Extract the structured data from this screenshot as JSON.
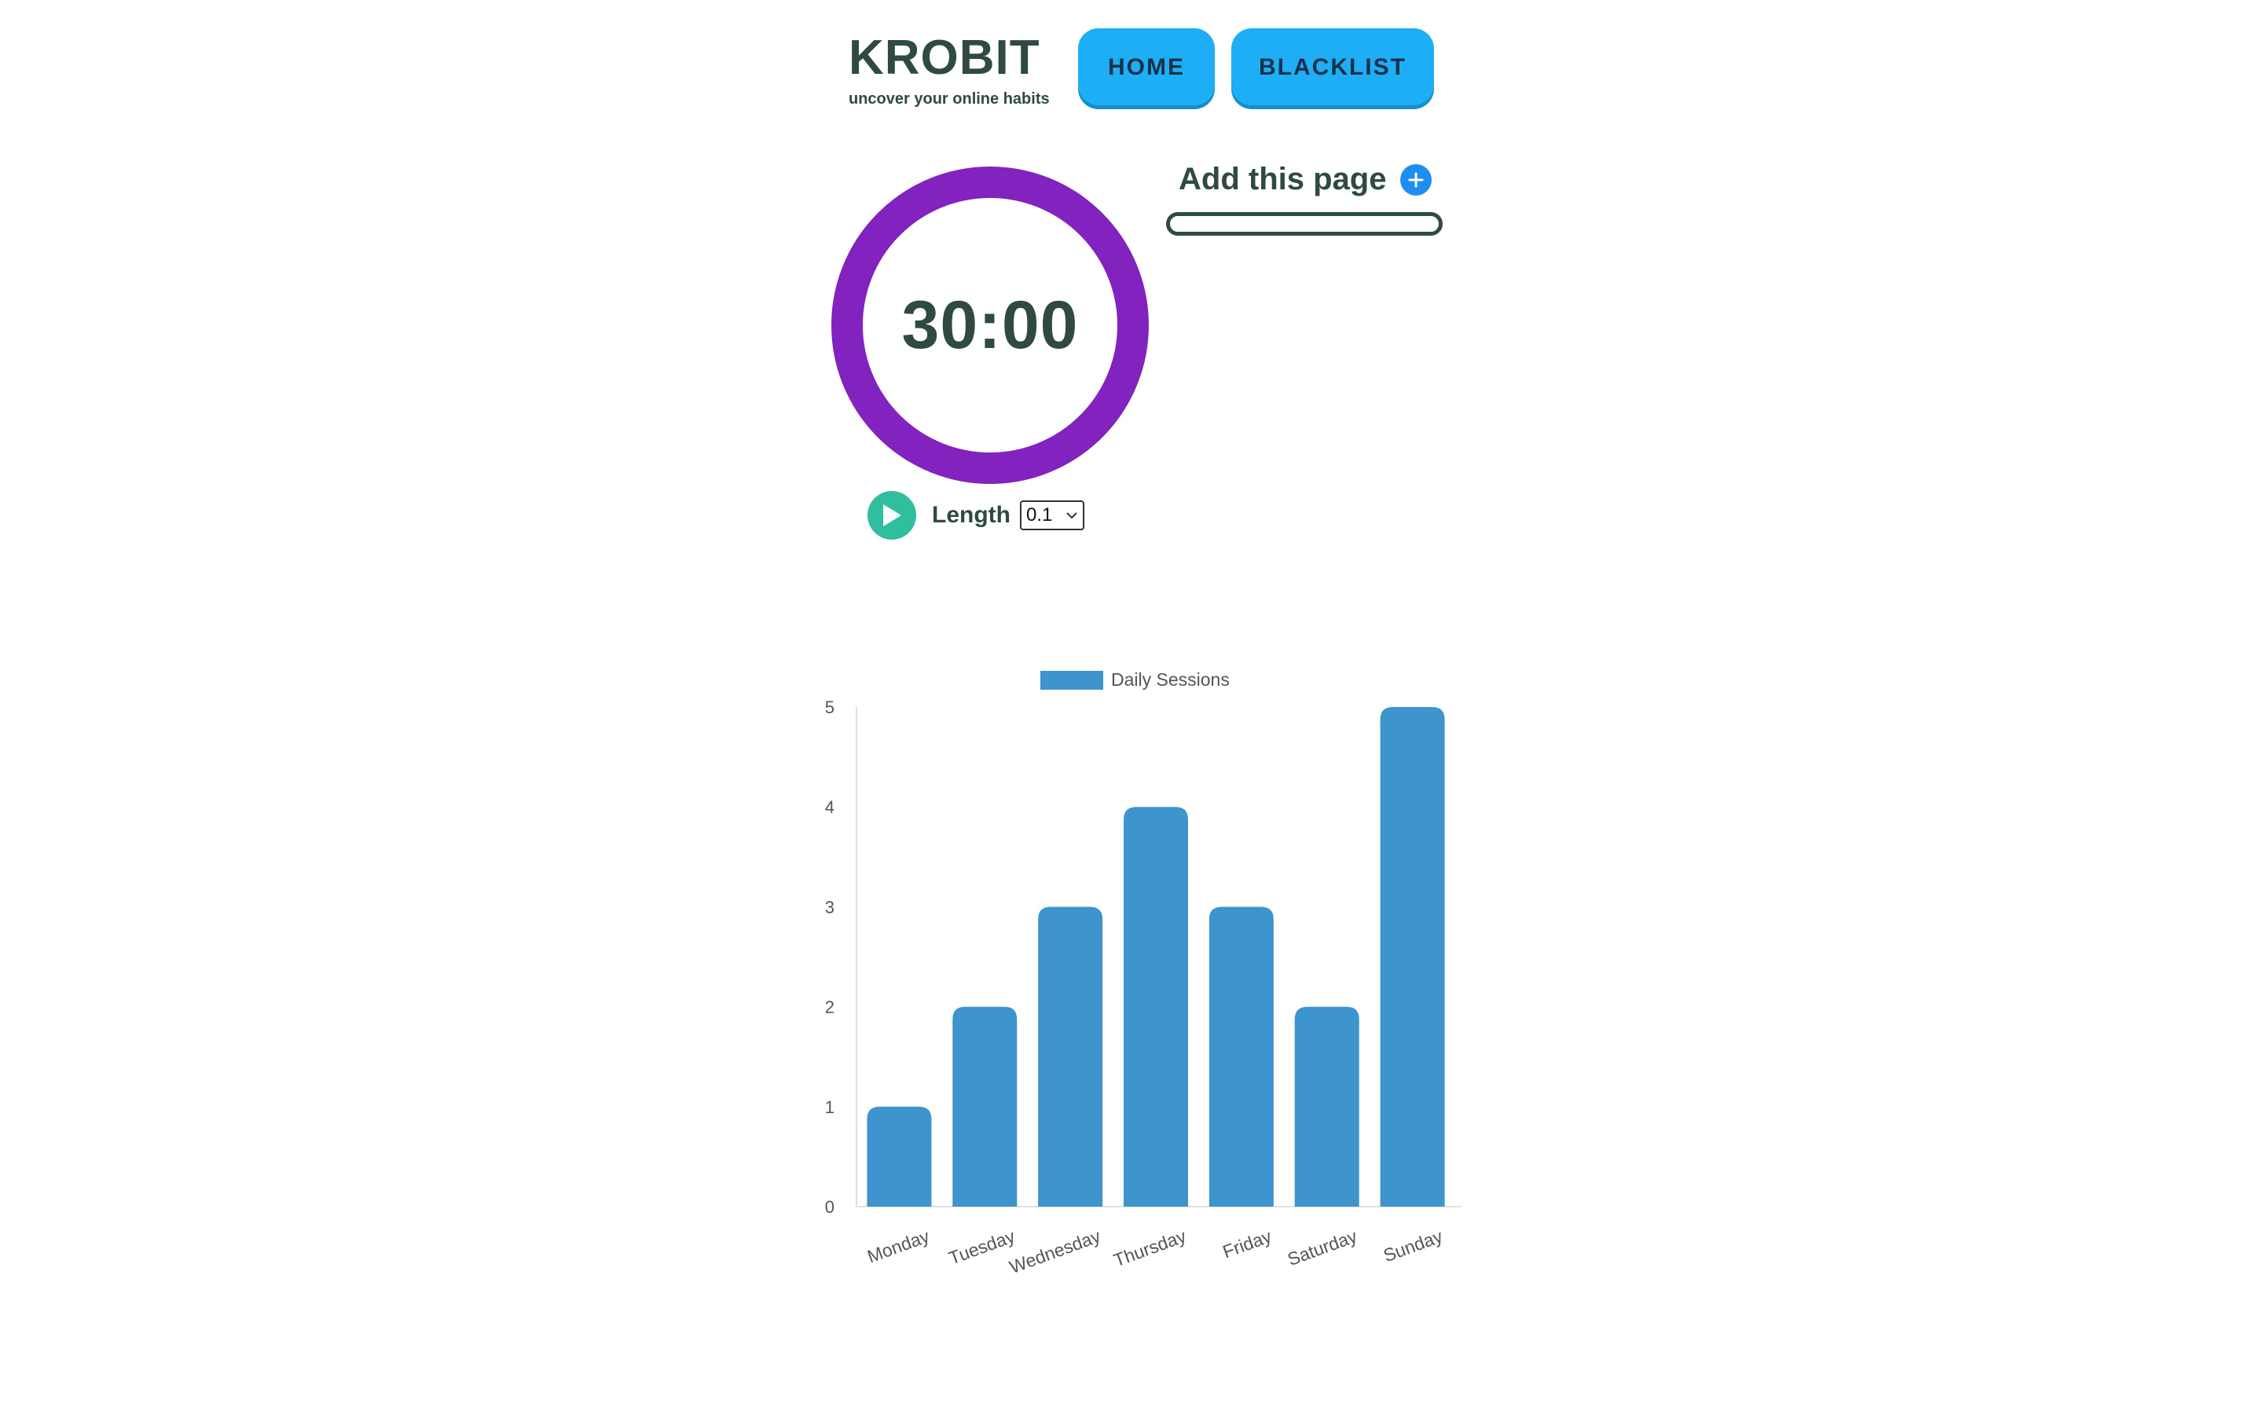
{
  "header": {
    "title": "KROBIT",
    "subtitle": "uncover your online habits",
    "nav": [
      {
        "label": "HOME"
      },
      {
        "label": "BLACKLIST"
      }
    ]
  },
  "timer": {
    "display": "30:00",
    "ring_color": "#8223bf"
  },
  "controls": {
    "play_icon": "play-icon",
    "length_label": "Length",
    "length_value": "0.1"
  },
  "blacklist": {
    "add_label": "Add this page",
    "add_icon": "plus-icon",
    "input_value": ""
  },
  "colors": {
    "accent": "#1eaef5",
    "text": "#2f4a40",
    "play": "#2fbf9f",
    "bar": "#3e95cd"
  },
  "chart_data": {
    "type": "bar",
    "categories": [
      "Monday",
      "Tuesday",
      "Wednesday",
      "Thursday",
      "Friday",
      "Saturday",
      "Sunday"
    ],
    "series": [
      {
        "name": "Daily Sessions",
        "values": [
          1,
          2,
          3,
          4,
          3,
          2,
          5
        ]
      }
    ],
    "ylim": [
      0,
      5
    ],
    "yticks": [
      "0",
      "1",
      "2",
      "3",
      "4",
      "5"
    ],
    "legend": "top-center",
    "grid": false
  }
}
